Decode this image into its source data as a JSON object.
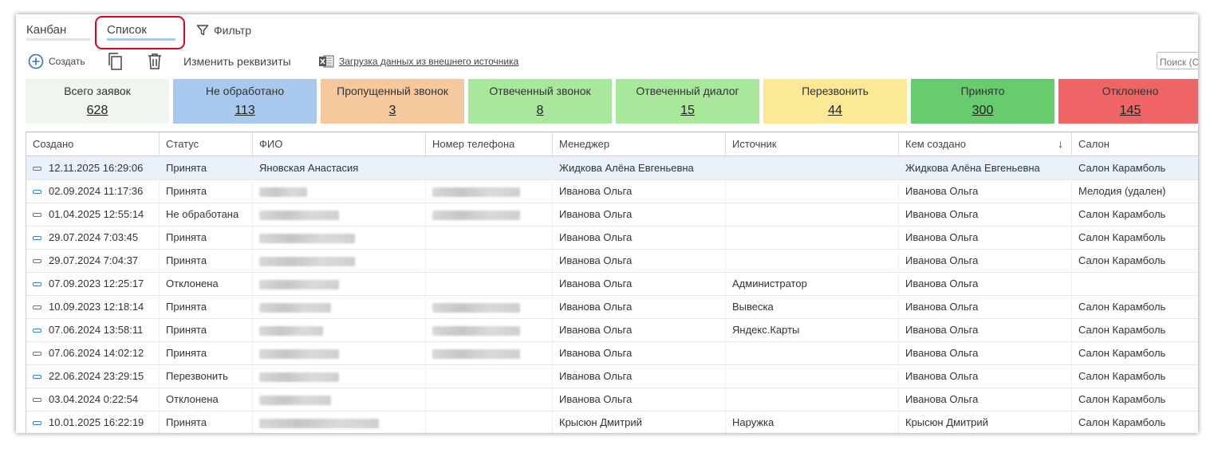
{
  "tabs": {
    "kanban": "Канбан",
    "list": "Список",
    "filter": "Фильтр"
  },
  "toolbar": {
    "create": "Создать",
    "edit": "Изменить реквизиты",
    "import": "Загрузка данных из внешнего источника",
    "search_placeholder": "Поиск (Ctrl+F)"
  },
  "cards": [
    {
      "title": "Всего заявок",
      "count": "628",
      "color": "#eef6ef"
    },
    {
      "title": "Не обработано",
      "count": "113",
      "color": "#a8c8ee"
    },
    {
      "title": "Пропущенный звонок",
      "count": "3",
      "color": "#f5c99d"
    },
    {
      "title": "Отвеченный звонок",
      "count": "8",
      "color": "#a9e89a"
    },
    {
      "title": "Отвеченный диалог",
      "count": "15",
      "color": "#a9e89a"
    },
    {
      "title": "Перезвонить",
      "count": "44",
      "color": "#fbe995"
    },
    {
      "title": "Принято",
      "count": "300",
      "color": "#66cc6e"
    },
    {
      "title": "Отклонено",
      "count": "145",
      "color": "#ef6565"
    }
  ],
  "columns": [
    "Создано",
    "Статус",
    "ФИО",
    "Номер телефона",
    "Менеджер",
    "Источник",
    "Кем создано",
    "Салон"
  ],
  "rows": [
    {
      "created": "12.11.2025 16:29:06",
      "status": "Принята",
      "fio": "Яновская Анастасия",
      "manager": "Жидкова Алёна Евгеньевна",
      "source": "",
      "creator": "Жидкова Алёна Евгеньевна",
      "salon": "Салон Карамболь"
    },
    {
      "created": "02.09.2024 11:17:36",
      "status": "Принята",
      "fio": "",
      "manager": "Иванова Ольга",
      "source": "",
      "creator": "Иванова Ольга",
      "salon": "Мелодия (удален)"
    },
    {
      "created": "01.04.2025 12:55:14",
      "status": "Не обработана",
      "fio": "",
      "manager": "Иванова Ольга",
      "source": "",
      "creator": "Иванова Ольга",
      "salon": "Салон Карамболь"
    },
    {
      "created": "29.07.2024 7:03:45",
      "status": "Принята",
      "fio": "",
      "manager": "Иванова Ольга",
      "source": "",
      "creator": "Иванова Ольга",
      "salon": "Салон Карамболь"
    },
    {
      "created": "29.07.2024 7:04:37",
      "status": "Принята",
      "fio": "",
      "manager": "Иванова Ольга",
      "source": "",
      "creator": "Иванова Ольга",
      "salon": "Салон Карамболь"
    },
    {
      "created": "07.09.2023 12:25:17",
      "status": "Отклонена",
      "fio": "",
      "manager": "Иванова Ольга",
      "source": "Администратор",
      "creator": "Иванова Ольга",
      "salon": ""
    },
    {
      "created": "10.09.2023 12:18:14",
      "status": "Принята",
      "fio": "",
      "manager": "Иванова Ольга",
      "source": "Вывеска",
      "creator": "Иванова Ольга",
      "salon": "Салон Карамболь"
    },
    {
      "created": "07.06.2024 13:58:11",
      "status": "Принята",
      "fio": "",
      "manager": "Иванова Ольга",
      "source": "Яндекс.Карты",
      "creator": "Иванова Ольга",
      "salon": "Салон Карамболь"
    },
    {
      "created": "07.06.2024 14:02:12",
      "status": "Принята",
      "fio": "",
      "manager": "Иванова Ольга",
      "source": "",
      "creator": "Иванова Ольга",
      "salon": "Салон Карамболь"
    },
    {
      "created": "22.06.2024 23:29:15",
      "status": "Перезвонить",
      "fio": "",
      "manager": "Иванова Ольга",
      "source": "",
      "creator": "Иванова Ольга",
      "salon": "Салон Карамболь"
    },
    {
      "created": "03.04.2024 0:22:54",
      "status": "Отклонена",
      "fio": "",
      "manager": "Иванова Ольга",
      "source": "",
      "creator": "Иванова Ольга",
      "salon": "Салон Карамболь"
    },
    {
      "created": "10.01.2025 16:22:19",
      "status": "Принята",
      "fio": "",
      "manager": "Крысюн Дмитрий",
      "source": "Наружка",
      "creator": "Крысюн Дмитрий",
      "salon": "Салон Карамболь"
    }
  ]
}
